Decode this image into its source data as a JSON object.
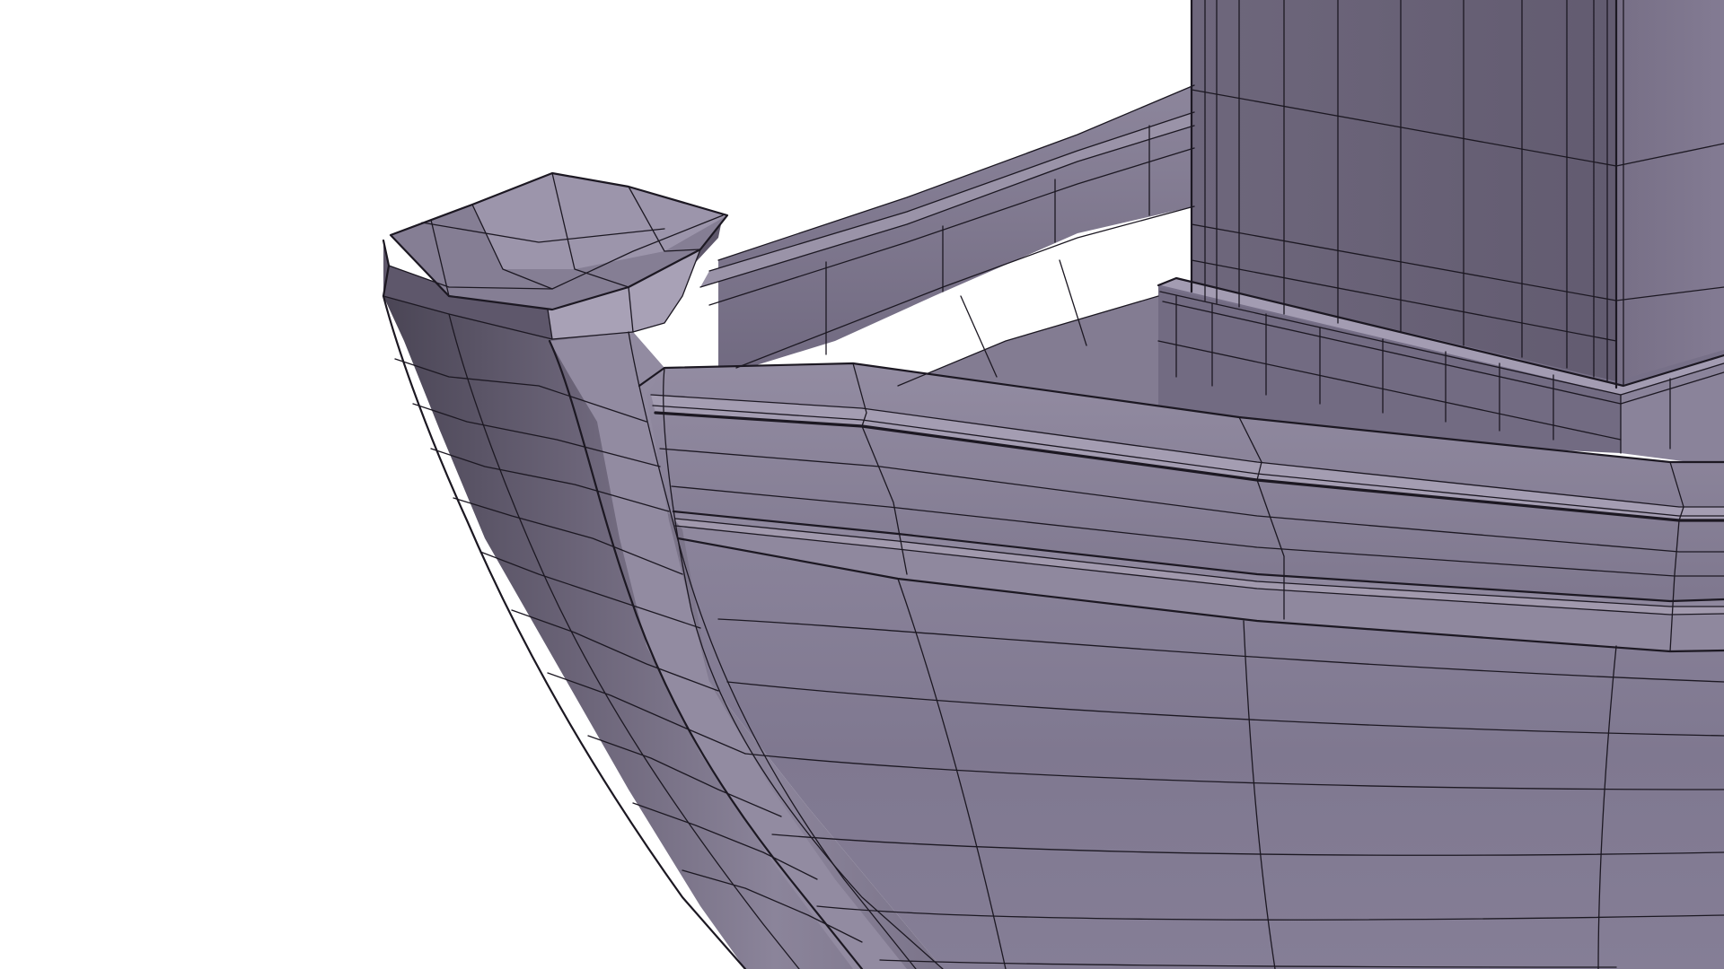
{
  "viewport": {
    "background": "#ffffff",
    "view": "perspective-wireframe-on-shaded"
  },
  "model": {
    "object": "boat-hull-bow",
    "parts": [
      "hull",
      "stem-post",
      "gunwale-rail",
      "inner-rim",
      "deckhouse-cabin",
      "cabin-base-plinth"
    ],
    "shading": {
      "base_color": "#7b7389",
      "light_color": "#968fa4",
      "dark_color": "#4f4a5a",
      "wire_color": "#1c1822"
    }
  },
  "icons": {
    "subject": "boat-icon"
  }
}
